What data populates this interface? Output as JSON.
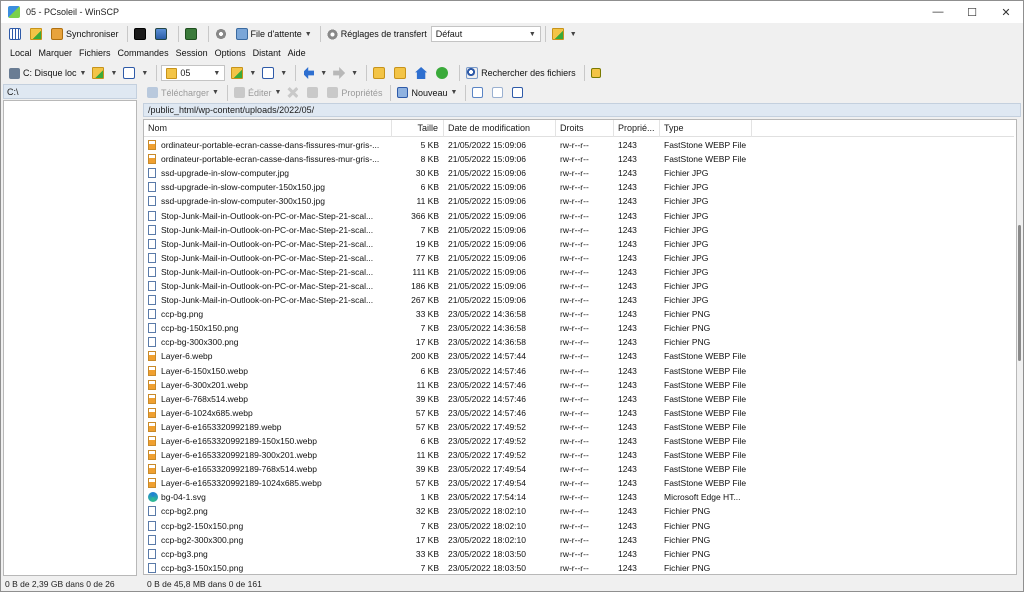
{
  "window": {
    "title": "05 - PCsoleil - WinSCP",
    "minimize": "—",
    "maximize": "☐",
    "close": "✕"
  },
  "toolbar1": {
    "synchronize": "Synchroniser",
    "queue": "File d'attente",
    "transfer_settings_label": "Réglages de transfert",
    "transfer_settings_value": "Défaut"
  },
  "menu": [
    "Local",
    "Marquer",
    "Fichiers",
    "Commandes",
    "Session",
    "Options",
    "Distant",
    "Aide"
  ],
  "toolbar2": {
    "local_drive": "C: Disque loc",
    "remote_folder": "05",
    "find_files": "Rechercher des fichiers"
  },
  "remote_toolbar": {
    "download": "Télécharger",
    "edit": "Éditer",
    "properties": "Propriétés",
    "new": "Nouveau"
  },
  "local_path": "C:\\",
  "remote_path": "/public_html/wp-content/uploads/2022/05/",
  "columns": {
    "name": "Nom",
    "size": "Taille",
    "date": "Date de modification",
    "rights": "Droits",
    "owner": "Proprié...",
    "type": "Type"
  },
  "files": [
    {
      "icon": "webp",
      "name": "ordinateur-portable-ecran-casse-dans-fissures-mur-gris-...",
      "size": "5 KB",
      "date": "21/05/2022 15:09:06",
      "rights": "rw-r--r--",
      "owner": "1243",
      "type": "FastStone WEBP File"
    },
    {
      "icon": "webp",
      "name": "ordinateur-portable-ecran-casse-dans-fissures-mur-gris-...",
      "size": "8 KB",
      "date": "21/05/2022 15:09:06",
      "rights": "rw-r--r--",
      "owner": "1243",
      "type": "FastStone WEBP File"
    },
    {
      "icon": "file",
      "name": "ssd-upgrade-in-slow-computer.jpg",
      "size": "30 KB",
      "date": "21/05/2022 15:09:06",
      "rights": "rw-r--r--",
      "owner": "1243",
      "type": "Fichier JPG"
    },
    {
      "icon": "file",
      "name": "ssd-upgrade-in-slow-computer-150x150.jpg",
      "size": "6 KB",
      "date": "21/05/2022 15:09:06",
      "rights": "rw-r--r--",
      "owner": "1243",
      "type": "Fichier JPG"
    },
    {
      "icon": "file",
      "name": "ssd-upgrade-in-slow-computer-300x150.jpg",
      "size": "11 KB",
      "date": "21/05/2022 15:09:06",
      "rights": "rw-r--r--",
      "owner": "1243",
      "type": "Fichier JPG"
    },
    {
      "icon": "file",
      "name": "Stop-Junk-Mail-in-Outlook-on-PC-or-Mac-Step-21-scal...",
      "size": "366 KB",
      "date": "21/05/2022 15:09:06",
      "rights": "rw-r--r--",
      "owner": "1243",
      "type": "Fichier JPG"
    },
    {
      "icon": "file",
      "name": "Stop-Junk-Mail-in-Outlook-on-PC-or-Mac-Step-21-scal...",
      "size": "7 KB",
      "date": "21/05/2022 15:09:06",
      "rights": "rw-r--r--",
      "owner": "1243",
      "type": "Fichier JPG"
    },
    {
      "icon": "file",
      "name": "Stop-Junk-Mail-in-Outlook-on-PC-or-Mac-Step-21-scal...",
      "size": "19 KB",
      "date": "21/05/2022 15:09:06",
      "rights": "rw-r--r--",
      "owner": "1243",
      "type": "Fichier JPG"
    },
    {
      "icon": "file",
      "name": "Stop-Junk-Mail-in-Outlook-on-PC-or-Mac-Step-21-scal...",
      "size": "77 KB",
      "date": "21/05/2022 15:09:06",
      "rights": "rw-r--r--",
      "owner": "1243",
      "type": "Fichier JPG"
    },
    {
      "icon": "file",
      "name": "Stop-Junk-Mail-in-Outlook-on-PC-or-Mac-Step-21-scal...",
      "size": "111 KB",
      "date": "21/05/2022 15:09:06",
      "rights": "rw-r--r--",
      "owner": "1243",
      "type": "Fichier JPG"
    },
    {
      "icon": "file",
      "name": "Stop-Junk-Mail-in-Outlook-on-PC-or-Mac-Step-21-scal...",
      "size": "186 KB",
      "date": "21/05/2022 15:09:06",
      "rights": "rw-r--r--",
      "owner": "1243",
      "type": "Fichier JPG"
    },
    {
      "icon": "file",
      "name": "Stop-Junk-Mail-in-Outlook-on-PC-or-Mac-Step-21-scal...",
      "size": "267 KB",
      "date": "21/05/2022 15:09:06",
      "rights": "rw-r--r--",
      "owner": "1243",
      "type": "Fichier JPG"
    },
    {
      "icon": "file",
      "name": "ccp-bg.png",
      "size": "33 KB",
      "date": "23/05/2022 14:36:58",
      "rights": "rw-r--r--",
      "owner": "1243",
      "type": "Fichier PNG"
    },
    {
      "icon": "file",
      "name": "ccp-bg-150x150.png",
      "size": "7 KB",
      "date": "23/05/2022 14:36:58",
      "rights": "rw-r--r--",
      "owner": "1243",
      "type": "Fichier PNG"
    },
    {
      "icon": "file",
      "name": "ccp-bg-300x300.png",
      "size": "17 KB",
      "date": "23/05/2022 14:36:58",
      "rights": "rw-r--r--",
      "owner": "1243",
      "type": "Fichier PNG"
    },
    {
      "icon": "webp",
      "name": "Layer-6.webp",
      "size": "200 KB",
      "date": "23/05/2022 14:57:44",
      "rights": "rw-r--r--",
      "owner": "1243",
      "type": "FastStone WEBP File"
    },
    {
      "icon": "webp",
      "name": "Layer-6-150x150.webp",
      "size": "6 KB",
      "date": "23/05/2022 14:57:46",
      "rights": "rw-r--r--",
      "owner": "1243",
      "type": "FastStone WEBP File"
    },
    {
      "icon": "webp",
      "name": "Layer-6-300x201.webp",
      "size": "11 KB",
      "date": "23/05/2022 14:57:46",
      "rights": "rw-r--r--",
      "owner": "1243",
      "type": "FastStone WEBP File"
    },
    {
      "icon": "webp",
      "name": "Layer-6-768x514.webp",
      "size": "39 KB",
      "date": "23/05/2022 14:57:46",
      "rights": "rw-r--r--",
      "owner": "1243",
      "type": "FastStone WEBP File"
    },
    {
      "icon": "webp",
      "name": "Layer-6-1024x685.webp",
      "size": "57 KB",
      "date": "23/05/2022 14:57:46",
      "rights": "rw-r--r--",
      "owner": "1243",
      "type": "FastStone WEBP File"
    },
    {
      "icon": "webp",
      "name": "Layer-6-e1653320992189.webp",
      "size": "57 KB",
      "date": "23/05/2022 17:49:52",
      "rights": "rw-r--r--",
      "owner": "1243",
      "type": "FastStone WEBP File"
    },
    {
      "icon": "webp",
      "name": "Layer-6-e1653320992189-150x150.webp",
      "size": "6 KB",
      "date": "23/05/2022 17:49:52",
      "rights": "rw-r--r--",
      "owner": "1243",
      "type": "FastStone WEBP File"
    },
    {
      "icon": "webp",
      "name": "Layer-6-e1653320992189-300x201.webp",
      "size": "11 KB",
      "date": "23/05/2022 17:49:52",
      "rights": "rw-r--r--",
      "owner": "1243",
      "type": "FastStone WEBP File"
    },
    {
      "icon": "webp",
      "name": "Layer-6-e1653320992189-768x514.webp",
      "size": "39 KB",
      "date": "23/05/2022 17:49:54",
      "rights": "rw-r--r--",
      "owner": "1243",
      "type": "FastStone WEBP File"
    },
    {
      "icon": "webp",
      "name": "Layer-6-e1653320992189-1024x685.webp",
      "size": "57 KB",
      "date": "23/05/2022 17:49:54",
      "rights": "rw-r--r--",
      "owner": "1243",
      "type": "FastStone WEBP File"
    },
    {
      "icon": "edge",
      "name": "bg-04-1.svg",
      "size": "1 KB",
      "date": "23/05/2022 17:54:14",
      "rights": "rw-r--r--",
      "owner": "1243",
      "type": "Microsoft Edge HT..."
    },
    {
      "icon": "file",
      "name": "ccp-bg2.png",
      "size": "32 KB",
      "date": "23/05/2022 18:02:10",
      "rights": "rw-r--r--",
      "owner": "1243",
      "type": "Fichier PNG"
    },
    {
      "icon": "file",
      "name": "ccp-bg2-150x150.png",
      "size": "7 KB",
      "date": "23/05/2022 18:02:10",
      "rights": "rw-r--r--",
      "owner": "1243",
      "type": "Fichier PNG"
    },
    {
      "icon": "file",
      "name": "ccp-bg2-300x300.png",
      "size": "17 KB",
      "date": "23/05/2022 18:02:10",
      "rights": "rw-r--r--",
      "owner": "1243",
      "type": "Fichier PNG"
    },
    {
      "icon": "file",
      "name": "ccp-bg3.png",
      "size": "33 KB",
      "date": "23/05/2022 18:03:50",
      "rights": "rw-r--r--",
      "owner": "1243",
      "type": "Fichier PNG"
    },
    {
      "icon": "file",
      "name": "ccp-bg3-150x150.png",
      "size": "7 KB",
      "date": "23/05/2022 18:03:50",
      "rights": "rw-r--r--",
      "owner": "1243",
      "type": "Fichier PNG"
    }
  ],
  "status": {
    "local": "0 B de 2,39 GB dans 0 de 26",
    "remote": "0 B de 45,8 MB dans 0 de 161"
  }
}
